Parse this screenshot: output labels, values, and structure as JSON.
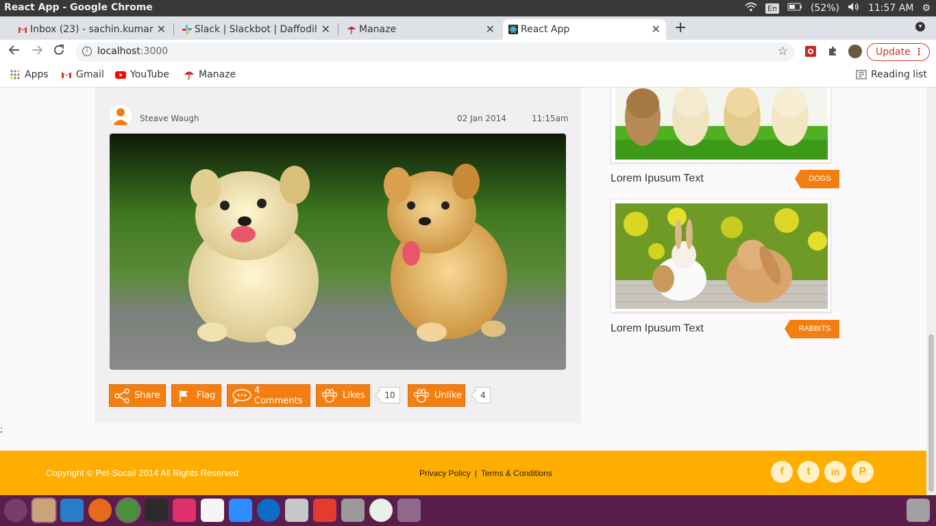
{
  "os": {
    "window_title": "React App - Google Chrome",
    "lang": "En",
    "battery": "(52%)",
    "time": "11:57 AM"
  },
  "browser": {
    "tabs": [
      {
        "title": "Inbox (23) - sachin.kumar",
        "icon": "gmail-icon",
        "active": false
      },
      {
        "title": "Slack | Slackbot | Daffodil",
        "icon": "slack-icon",
        "active": false
      },
      {
        "title": "Manaze",
        "icon": "umbrella-icon",
        "active": false
      },
      {
        "title": "React App",
        "icon": "react-icon",
        "active": true
      }
    ],
    "url_host": "localhost",
    "url_rest": ":3000",
    "update_label": "Update",
    "bookmarks": [
      {
        "label": "Apps",
        "icon": "apps-grid-icon"
      },
      {
        "label": "Gmail",
        "icon": "gmail-icon"
      },
      {
        "label": "YouTube",
        "icon": "youtube-icon"
      },
      {
        "label": "Manaze",
        "icon": "umbrella-icon"
      }
    ],
    "reading_list": "Reading list"
  },
  "post": {
    "author": "Steave Waugh",
    "date": "02 Jan 2014",
    "time": "11:15am",
    "actions": {
      "share": "Share",
      "flag": "Flag",
      "comments": "4 Comments",
      "likes": "Likes",
      "likes_count": "10",
      "unlike": "Unlike",
      "unlike_count": "4"
    }
  },
  "sidebar": {
    "cards": [
      {
        "title": "Lorem Ipusum Text",
        "tag": "DOGS"
      },
      {
        "title": "Lorem Ipusum Text",
        "tag": "RABBITS"
      }
    ]
  },
  "stray_text": ";",
  "footer": {
    "copyright": "Copyright © Pet-Socail 2014 All Rights Reserved",
    "privacy": "Privacy Policy",
    "separator": "|",
    "terms": "Terms & Conditions",
    "social": [
      {
        "glyph": "f",
        "icon": "facebook-icon"
      },
      {
        "glyph": "t",
        "icon": "twitter-icon"
      },
      {
        "glyph": "in",
        "icon": "linkedin-icon"
      },
      {
        "glyph": "P",
        "icon": "pinterest-icon"
      }
    ]
  },
  "colors": {
    "accent": "#f47f11",
    "footer": "#ffae00",
    "dock": "#5a1e4d"
  }
}
